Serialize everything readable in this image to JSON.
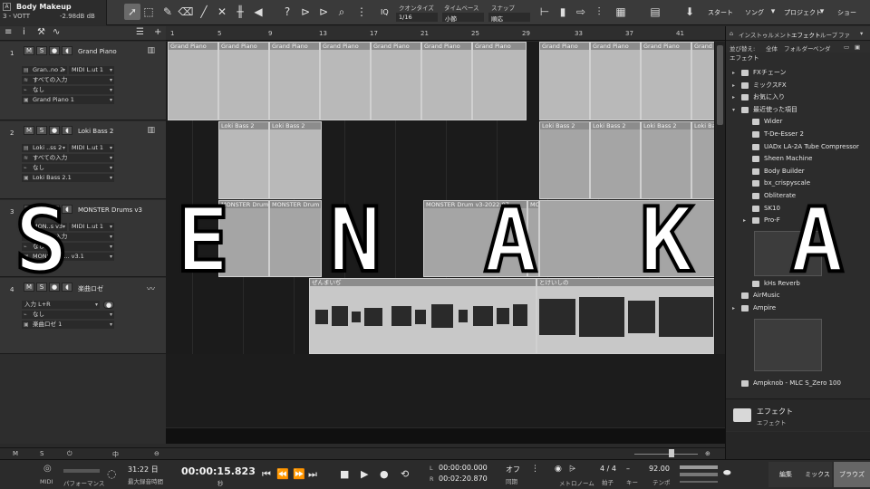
{
  "song": {
    "title": "Body Makeup",
    "version": "3 - VOTT",
    "gain": "-2.98dB dB"
  },
  "toolbar": {
    "quantize_label": "クオンタイズ",
    "quantize_value": "1/16",
    "timebase_label": "タイムベース",
    "timebase_value": "小節",
    "snap_label": "スナップ",
    "snap_value": "順応",
    "iq": "IQ",
    "nav": {
      "start": "スタート",
      "song": "ソング",
      "project": "プロジェクト",
      "show": "ショー"
    }
  },
  "ruler_ticks": [
    "1",
    "5",
    "9",
    "13",
    "17",
    "21",
    "25",
    "29",
    "33",
    "37",
    "41"
  ],
  "tracks": [
    {
      "num": "1",
      "name": "Grand Piano",
      "row1a": "Gran..no 2",
      "row1b": "MIDI L.ut 1",
      "row2": "すべての入力",
      "row3": "なし",
      "row4": "Grand Piano 1"
    },
    {
      "num": "2",
      "name": "Loki Bass 2",
      "row1a": "Loki ..ss 2",
      "row1b": "MIDI L.ut 1",
      "row2": "すべての入力",
      "row3": "なし",
      "row4": "Loki Bass 2.1"
    },
    {
      "num": "3",
      "name": "MONSTER Drums v3",
      "row1a": "MON..s v3",
      "row1b": "MIDI L.ut 1",
      "row2": "すべての入力",
      "row3": "なし",
      "row4": "MONSTER ... v3.1"
    },
    {
      "num": "4",
      "name": "楽曲ロゼ",
      "row1a": "入力 L+R",
      "row1b": "",
      "row2": "なし",
      "row3": "楽曲ロゼ 1",
      "row4": ""
    }
  ],
  "clips": {
    "piano": "Grand Piano",
    "bass": "Loki Bass 2",
    "drums_a": "MONSTER Drum",
    "drums_b": "MONSTER Drum v3-2022.07",
    "drums_c": "MO",
    "audio_a": "ぜんまいぢ",
    "audio_b": "とけいしの"
  },
  "track_buttons": {
    "mute": "M",
    "solo": "S"
  },
  "browser": {
    "tabs": [
      "インストゥルメント",
      "エフェクト",
      "ループ",
      "ファ"
    ],
    "sort_label": "並び替え:",
    "sort_all": "全体",
    "sort_folder": "フォルダー",
    "sort_vendor": "ベンダ",
    "path": "エフェクト",
    "items": [
      {
        "label": "FXチェーン",
        "indent": 1,
        "icon": "folder-icon",
        "expand": "▸"
      },
      {
        "label": "ミックスFX",
        "indent": 1,
        "icon": "folder-icon",
        "expand": "▸"
      },
      {
        "label": "お気に入り",
        "indent": 1,
        "icon": "star-icon",
        "expand": "▸"
      },
      {
        "label": "最近使った項目",
        "indent": 1,
        "icon": "clock-icon",
        "expand": "▾"
      },
      {
        "label": "Wider",
        "indent": 2,
        "icon": "plugin-icon",
        "expand": ""
      },
      {
        "label": "T-De-Esser 2",
        "indent": 2,
        "icon": "plugin-icon",
        "expand": ""
      },
      {
        "label": "UADx LA-2A Tube Compressor",
        "indent": 2,
        "icon": "plugin-icon",
        "expand": ""
      },
      {
        "label": "Sheen Machine",
        "indent": 2,
        "icon": "plugin-icon",
        "expand": ""
      },
      {
        "label": "Body Builder",
        "indent": 2,
        "icon": "plugin-icon",
        "expand": ""
      },
      {
        "label": "bx_crispyscale",
        "indent": 2,
        "icon": "plugin-icon",
        "expand": ""
      },
      {
        "label": "Obliterate",
        "indent": 2,
        "icon": "plugin-icon",
        "expand": ""
      },
      {
        "label": "SK10",
        "indent": 2,
        "icon": "plugin-icon",
        "expand": ""
      },
      {
        "label": "Pro-F",
        "indent": 2,
        "icon": "fx-icon",
        "expand": "▸"
      }
    ],
    "items_lower": [
      {
        "label": "kHs Reverb",
        "indent": 2,
        "icon": "plugin-icon",
        "expand": ""
      },
      {
        "label": "AirMusic",
        "indent": 1,
        "icon": "fx-icon",
        "expand": ""
      },
      {
        "label": "Ampire",
        "indent": 1,
        "icon": "fx-icon",
        "expand": "▸"
      },
      {
        "label": "Ampknob - MLC S_Zero 100",
        "indent": 1,
        "icon": "plugin-icon",
        "expand": ""
      }
    ],
    "footer_title": "エフェクト",
    "footer_sub": "エフェクト"
  },
  "transport": {
    "midi": "MIDI",
    "performance": "パフォーマンス",
    "record_time": "31:22 日",
    "record_time_label": "最大録音時間",
    "position": "00:00:15.823",
    "position_unit": "秒",
    "loop_l": "00:00:00.000",
    "loop_r": "00:02:20.870",
    "sync": "オフ",
    "sync_label": "同期",
    "metronome_label": "メトロノーム",
    "signature": "4 / 4",
    "signature_label": "拍子",
    "key_label": "キー",
    "tempo": "92.00",
    "tempo_label": "テンポ",
    "l_label": "L",
    "r_label": "R"
  },
  "bottom_tabs": {
    "edit": "編集",
    "mix": "ミックス",
    "browse": "ブラウズ"
  },
  "statusbar": {
    "m": "M",
    "s": "S",
    "mid": "中"
  },
  "overlay_text": [
    "S",
    "E",
    "N",
    "A",
    "K",
    "A"
  ]
}
